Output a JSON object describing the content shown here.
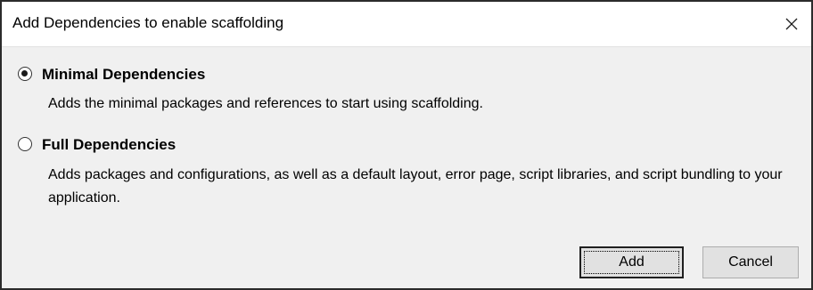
{
  "dialog": {
    "title": "Add Dependencies to enable scaffolding",
    "close_glyph": "✕"
  },
  "options": [
    {
      "label": "Minimal Dependencies",
      "selected": true,
      "description": "Adds the minimal packages and references to start using scaffolding."
    },
    {
      "label": "Full Dependencies",
      "selected": false,
      "description": "Adds packages and configurations, as well as a default layout, error page, script libraries, and script bundling to your application."
    }
  ],
  "buttons": {
    "add_label": "Add",
    "cancel_label": "Cancel"
  }
}
